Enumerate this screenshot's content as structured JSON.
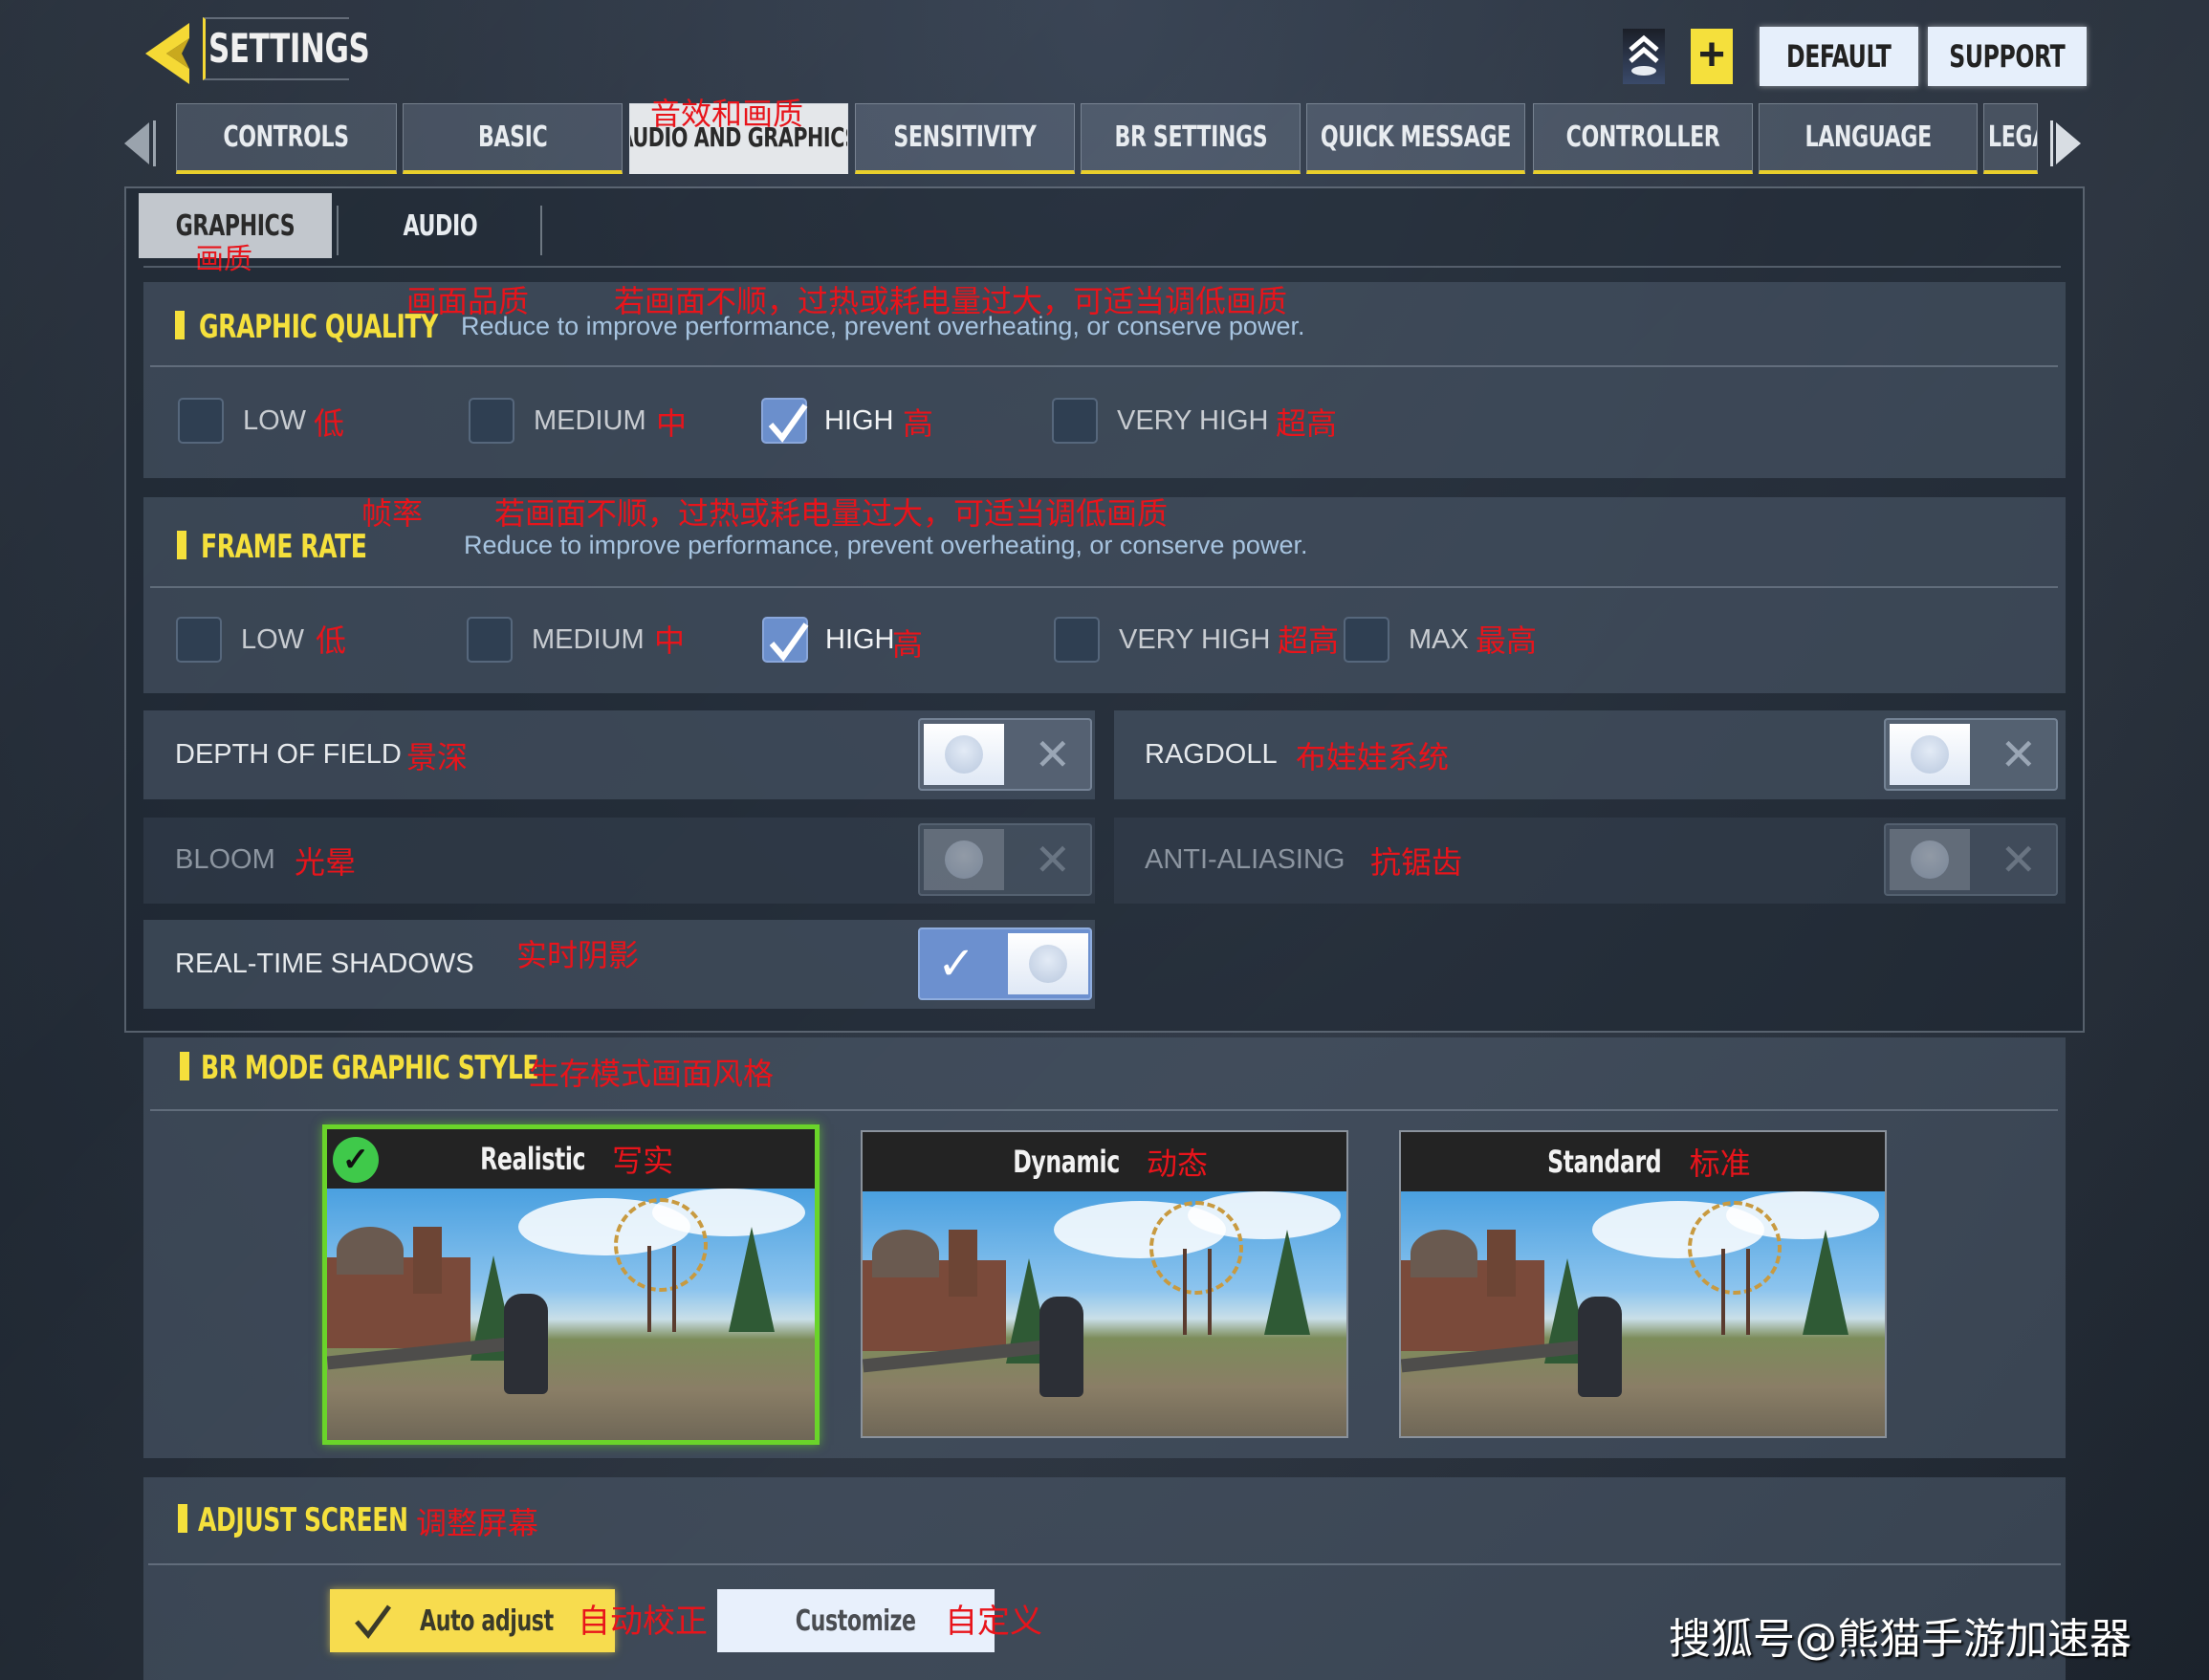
{
  "header": {
    "title": "SETTINGS",
    "buttons": {
      "default": "DEFAULT",
      "support": "SUPPORT",
      "plus": "+"
    }
  },
  "tabs": [
    {
      "label": "CONTROLS",
      "active": false
    },
    {
      "label": "BASIC",
      "active": false
    },
    {
      "label": "AUDIO AND GRAPHICS",
      "active": true,
      "note": "音效和画质"
    },
    {
      "label": "SENSITIVITY",
      "active": false
    },
    {
      "label": "BR SETTINGS",
      "active": false
    },
    {
      "label": "QUICK MESSAGE",
      "active": false
    },
    {
      "label": "CONTROLLER",
      "active": false
    },
    {
      "label": "LANGUAGE",
      "active": false
    },
    {
      "label": "LEGA",
      "active": false
    }
  ],
  "subtabs": [
    {
      "label": "GRAPHICS",
      "active": true,
      "note": "画质"
    },
    {
      "label": "AUDIO",
      "active": false
    }
  ],
  "graphic_quality": {
    "title": "GRAPHIC QUALITY",
    "title_note": "画面品质",
    "desc": "Reduce to improve performance, prevent overheating, or conserve power.",
    "desc_note": "若画面不顺，过热或耗电量过大，可适当调低画质",
    "options": [
      {
        "label": "LOW",
        "note": "低",
        "checked": false
      },
      {
        "label": "MEDIUM",
        "note": "中",
        "checked": false
      },
      {
        "label": "HIGH",
        "note": "高",
        "checked": true
      },
      {
        "label": "VERY HIGH",
        "note": "超高",
        "checked": false
      }
    ]
  },
  "frame_rate": {
    "title": "FRAME RATE",
    "title_note": "帧率",
    "desc": "Reduce to improve performance, prevent overheating, or conserve power.",
    "desc_note": "若画面不顺，过热或耗电量过大，可适当调低画质",
    "options": [
      {
        "label": "LOW",
        "note": "低",
        "checked": false
      },
      {
        "label": "MEDIUM",
        "note": "中",
        "checked": false
      },
      {
        "label": "HIGH",
        "note": "高",
        "checked": true
      },
      {
        "label": "VERY HIGH",
        "note": "超高",
        "checked": false
      },
      {
        "label": "MAX",
        "note": "最高",
        "checked": false
      }
    ]
  },
  "toggles": [
    {
      "label": "DEPTH OF FIELD",
      "note": "景深",
      "on": false,
      "enabled": true
    },
    {
      "label": "RAGDOLL",
      "note": "布娃娃系统",
      "on": false,
      "enabled": true
    },
    {
      "label": "BLOOM",
      "note": "光晕",
      "on": false,
      "enabled": false
    },
    {
      "label": "ANTI-ALIASING",
      "note": "抗锯齿",
      "on": false,
      "enabled": false
    },
    {
      "label": "REAL-TIME SHADOWS",
      "note": "实时阴影",
      "on": true,
      "enabled": true
    }
  ],
  "br_style": {
    "title": "BR MODE GRAPHIC STYLE",
    "title_note": "生存模式画面风格",
    "cards": [
      {
        "label": "Realistic",
        "note": "写实",
        "selected": true
      },
      {
        "label": "Dynamic",
        "note": "动态",
        "selected": false
      },
      {
        "label": "Standard",
        "note": "标准",
        "selected": false
      }
    ]
  },
  "adjust_screen": {
    "title": "ADJUST SCREEN",
    "title_note": "调整屏幕",
    "auto_label": "Auto adjust",
    "auto_note": "自动校正",
    "custom_label": "Customize",
    "custom_note": "自定义",
    "auto_selected": true
  },
  "watermark": "搜狐号@熊猫手游加速器",
  "colors": {
    "accent_yellow": "#f5e03c",
    "check_blue": "#6b8fcc",
    "selected_green": "#6ad42a",
    "annotation_red": "#e8141b"
  }
}
